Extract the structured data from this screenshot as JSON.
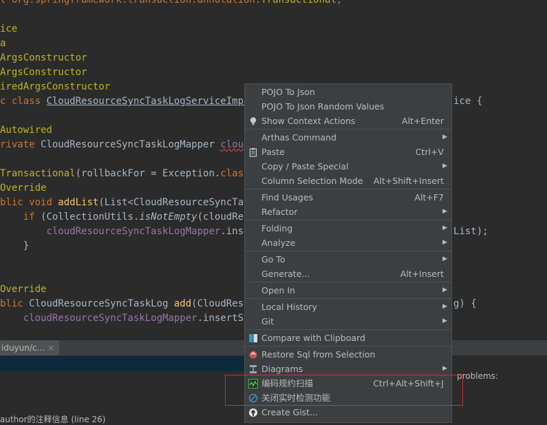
{
  "editor": {
    "lines": [
      {
        "segs": [
          {
            "t": "t org.springframework.transaction.annotation.",
            "c": "k"
          },
          {
            "t": "Transactional",
            "c": "ann"
          },
          {
            "t": ";",
            "c": "k"
          }
        ]
      },
      {
        "segs": []
      },
      {
        "segs": [
          {
            "t": "ice",
            "c": "ann"
          }
        ]
      },
      {
        "segs": [
          {
            "t": "a",
            "c": "ann"
          }
        ]
      },
      {
        "segs": [
          {
            "t": "ArgsConstructor",
            "c": "ann"
          }
        ]
      },
      {
        "segs": [
          {
            "t": "ArgsConstructor",
            "c": "ann"
          }
        ]
      },
      {
        "segs": [
          {
            "t": "iredArgsConstructor",
            "c": "ann"
          }
        ]
      },
      {
        "segs": [
          {
            "t": "c class ",
            "c": "k"
          },
          {
            "t": "CloudResourceSyncTaskLogServiceImpl",
            "c": "ul"
          },
          {
            "t": " i",
            "c": "k"
          }
        ]
      },
      {
        "segs": []
      },
      {
        "segs": [
          {
            "t": "Autowired",
            "c": "ann"
          }
        ]
      },
      {
        "segs": [
          {
            "t": "rivate ",
            "c": "k"
          },
          {
            "t": "CloudResourceSyncTaskLogMapper "
          },
          {
            "t": "cloudRe",
            "c": "fld uw"
          }
        ]
      },
      {
        "segs": []
      },
      {
        "segs": [
          {
            "t": "Transactional",
            "c": "ann"
          },
          {
            "t": "(rollbackFor = Exception."
          },
          {
            "t": "class",
            "c": "k"
          },
          {
            "t": ")"
          }
        ]
      },
      {
        "segs": [
          {
            "t": "Override",
            "c": "ann"
          }
        ]
      },
      {
        "segs": [
          {
            "t": "blic void ",
            "c": "k"
          },
          {
            "t": "addList",
            "c": "m"
          },
          {
            "t": "(List<CloudResourceSyncTask"
          }
        ]
      },
      {
        "segs": [
          {
            "t": "    "
          },
          {
            "t": "if ",
            "c": "k"
          },
          {
            "t": "(CollectionUtils."
          },
          {
            "t": "isNotEmpty",
            "c": "it"
          },
          {
            "t": "(cloudResour"
          }
        ]
      },
      {
        "segs": [
          {
            "t": "        "
          },
          {
            "t": "cloudResourceSyncTaskLogMapper",
            "c": "fld"
          },
          {
            "t": ".insertB"
          }
        ]
      },
      {
        "segs": [
          {
            "t": "    }"
          }
        ]
      },
      {
        "segs": []
      },
      {
        "segs": []
      },
      {
        "segs": [
          {
            "t": "Override",
            "c": "ann"
          }
        ]
      },
      {
        "segs": [
          {
            "t": "blic ",
            "c": "k"
          },
          {
            "t": "CloudResourceSyncTaskLog "
          },
          {
            "t": "add",
            "c": "m"
          },
          {
            "t": "(CloudResou"
          }
        ]
      },
      {
        "segs": [
          {
            "t": "    "
          },
          {
            "t": "cloudResourceSyncTaskLogMapper",
            "c": "fld"
          },
          {
            "t": ".insertSelec"
          }
        ]
      }
    ],
    "right_fragments": {
      "line7": "ice {",
      "line16": "List);",
      "line21": "g) {"
    }
  },
  "bottom": {
    "tab_label": "iduyun/c...",
    "tab_close": "×",
    "problems_text": "problems:",
    "author_text": "author的注释信息 (line 26)"
  },
  "menu": {
    "items": [
      {
        "label": "POJO To Json",
        "shortcut": "",
        "arrow": false,
        "icon": ""
      },
      {
        "label": "POJO To Json Random Values",
        "shortcut": "",
        "arrow": false,
        "icon": ""
      },
      {
        "label": "Show Context Actions",
        "shortcut": "Alt+Enter",
        "arrow": false,
        "icon": "lightbulb-icon"
      },
      {
        "label": "Arthas Command",
        "shortcut": "",
        "arrow": true,
        "icon": "",
        "sep_before": true
      },
      {
        "label": "Paste",
        "shortcut": "Ctrl+V",
        "arrow": false,
        "icon": "clipboard-icon"
      },
      {
        "label": "Copy / Paste Special",
        "shortcut": "",
        "arrow": true,
        "icon": ""
      },
      {
        "label": "Column Selection Mode",
        "shortcut": "Alt+Shift+Insert",
        "arrow": false,
        "icon": ""
      },
      {
        "label": "Find Usages",
        "shortcut": "Alt+F7",
        "arrow": false,
        "icon": "",
        "sep_before": true
      },
      {
        "label": "Refactor",
        "shortcut": "",
        "arrow": true,
        "icon": ""
      },
      {
        "label": "Folding",
        "shortcut": "",
        "arrow": true,
        "icon": "",
        "sep_before": true
      },
      {
        "label": "Analyze",
        "shortcut": "",
        "arrow": true,
        "icon": ""
      },
      {
        "label": "Go To",
        "shortcut": "",
        "arrow": true,
        "icon": "",
        "sep_before": true
      },
      {
        "label": "Generate...",
        "shortcut": "Alt+Insert",
        "arrow": false,
        "icon": ""
      },
      {
        "label": "Open In",
        "shortcut": "",
        "arrow": true,
        "icon": "",
        "sep_before": true
      },
      {
        "label": "Local History",
        "shortcut": "",
        "arrow": true,
        "icon": "",
        "sep_before": true
      },
      {
        "label": "Git",
        "shortcut": "",
        "arrow": true,
        "icon": ""
      },
      {
        "label": "Compare with Clipboard",
        "shortcut": "",
        "arrow": false,
        "icon": "compare-icon",
        "sep_before": true
      },
      {
        "label": "Restore Sql from Selection",
        "shortcut": "",
        "arrow": false,
        "icon": "sql-restore-icon",
        "sep_before": true
      },
      {
        "label": "Diagrams",
        "shortcut": "",
        "arrow": true,
        "icon": "diagram-icon"
      },
      {
        "label": "编码规约扫描",
        "shortcut": "Ctrl+Alt+Shift+J",
        "arrow": false,
        "icon": "code-scan-icon"
      },
      {
        "label": "关闭实时检测功能",
        "shortcut": "",
        "arrow": false,
        "icon": "disable-icon"
      },
      {
        "label": "Create Gist...",
        "shortcut": "",
        "arrow": false,
        "icon": "github-icon"
      }
    ],
    "colors": {
      "background": "#3c3f41",
      "separator": "#515151",
      "highlight_box": "#d9302c"
    }
  }
}
